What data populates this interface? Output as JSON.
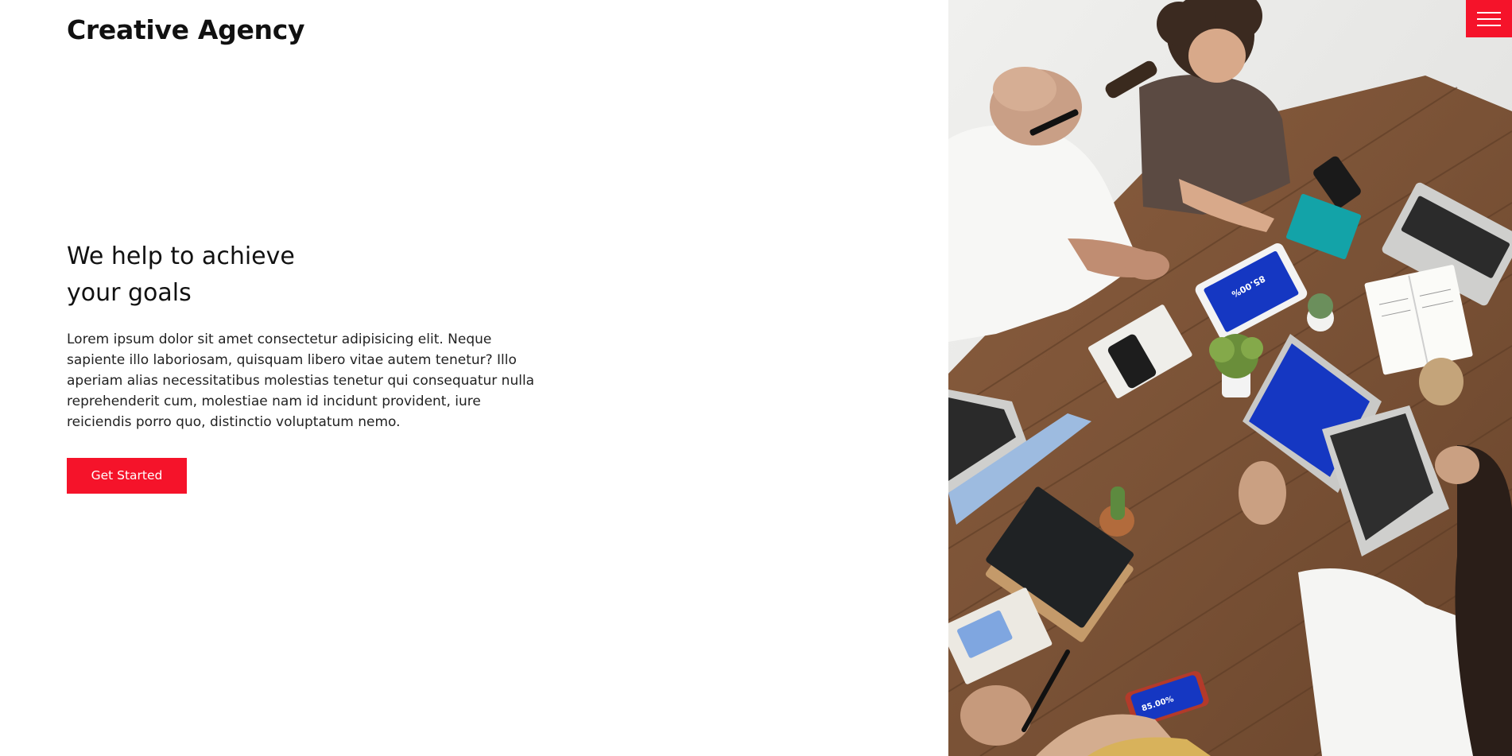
{
  "header": {
    "brand": "Creative Agency",
    "menu_icon": "hamburger-menu-icon"
  },
  "hero": {
    "heading_line1": "We help to achieve",
    "heading_line2": "your goals",
    "body": "Lorem ipsum dolor sit amet consectetur adipisicing elit. Neque sapiente illo laboriosam, quisquam libero vitae autem tenetur? Illo aperiam alias necessitatibus molestias tenetur qui consequatur nulla reprehenderit cum, molestiae nam id incidunt provident, iure reiciendis porro quo, distinctio voluptatum nemo.",
    "cta_label": "Get Started"
  },
  "photo": {
    "tablet_screen_text": "85.00%",
    "phone_screen_text": "85.00%"
  },
  "colors": {
    "accent": "#f5132a",
    "text": "#111111",
    "background": "#ffffff",
    "table_wood": "#7a5236",
    "screen_blue": "#1537c2"
  }
}
